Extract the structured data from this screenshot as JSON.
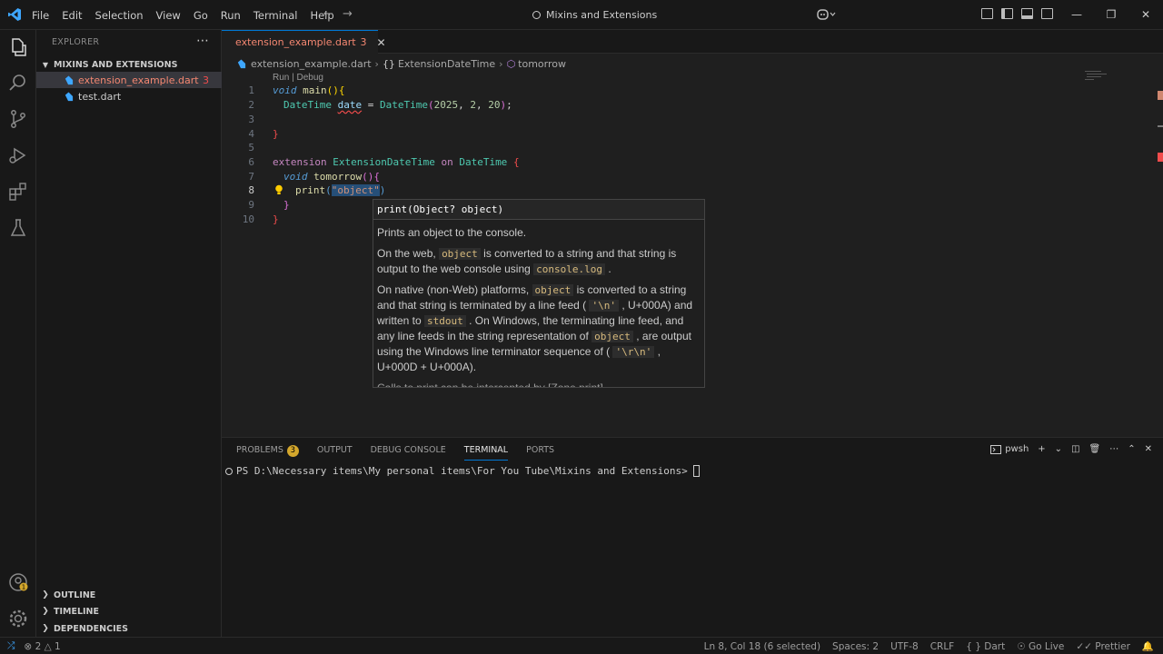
{
  "menu": [
    "File",
    "Edit",
    "Selection",
    "View",
    "Go",
    "Run",
    "Terminal",
    "Help"
  ],
  "command_center": "Mixins and Extensions",
  "explorer": {
    "header": "EXPLORER",
    "folder": "MIXINS AND EXTENSIONS",
    "files": [
      {
        "name": "extension_example.dart",
        "badge": "3"
      },
      {
        "name": "test.dart"
      }
    ],
    "sections": [
      "OUTLINE",
      "TIMELINE",
      "DEPENDENCIES"
    ]
  },
  "tab": {
    "label": "extension_example.dart",
    "problems": "3"
  },
  "breadcrumbs": [
    "extension_example.dart",
    "ExtensionDateTime",
    "tomorrow"
  ],
  "codelens": "Run | Debug",
  "line_numbers": [
    "1",
    "2",
    "3",
    "4",
    "5",
    "6",
    "7",
    "8",
    "9",
    "10"
  ],
  "code": {
    "l1": {
      "kw": "void",
      "fn": "main",
      "p1": "(",
      "p2": ")",
      "b": "{"
    },
    "l2": {
      "ty": "DateTime",
      "var": "date",
      "eq": " = ",
      "ctor": "DateTime",
      "open": "(",
      "n1": "2025",
      "c1": ", ",
      "n2": "2",
      "c2": ", ",
      "n3": "20",
      "close": ")",
      "semi": ";"
    },
    "l4": {
      "b": "}"
    },
    "l6": {
      "kw": "extension",
      "name": "ExtensionDateTime",
      "on": "on",
      "ty": "DateTime",
      "b": "{"
    },
    "l7": {
      "kw": "void",
      "fn": "tomorrow",
      "p1": "(",
      "p2": ")",
      "b": "{"
    },
    "l8": {
      "fn": "print",
      "open": "(",
      "str": "\"object\"",
      "close": ")"
    },
    "l9": {
      "b": "}"
    },
    "l10": {
      "b": "}"
    }
  },
  "hover": {
    "signature": "print(Object? object)",
    "p1": "Prints an object to the console.",
    "p2a": "On the web,",
    "p2code1": "object",
    "p2b": "is converted to a string and that string is output to the web console using",
    "p2code2": "console.log",
    "p2c": ".",
    "p3a": "On native (non-Web) platforms,",
    "p3code1": "object",
    "p3b": "is converted to a string and that string is terminated by a line feed (",
    "p3code2": "'\\n'",
    "p3c": ", U+000A) and written to",
    "p3code3": "stdout",
    "p3d": ". On Windows, the terminating line feed, and any line feeds in the string representation of",
    "p3code4": "object",
    "p3e": ", are output using the Windows line terminator sequence of (",
    "p3code5": "'\\r\\n'",
    "p3f": ", U+000D + U+000A).",
    "p4": "Calls to  print  can be intercepted by [Zone.print]."
  },
  "panel": {
    "tabs": [
      "PROBLEMS",
      "OUTPUT",
      "DEBUG CONSOLE",
      "TERMINAL",
      "PORTS"
    ],
    "problems_count": "3",
    "active_tab": "TERMINAL",
    "shell": "pwsh",
    "prompt": "PS D:\\Necessary items\\My personal items\\For You Tube\\Mixins and Extensions>"
  },
  "status": {
    "errors": "2",
    "warnings": "1",
    "position": "Ln 8, Col 18 (6 selected)",
    "spaces": "Spaces: 2",
    "encoding": "UTF-8",
    "eol": "CRLF",
    "language": "Dart",
    "golive": "Go Live",
    "prettier": "Prettier"
  },
  "colors": {
    "accent": "#0078d4",
    "error": "#f14c4c",
    "warning_badge": "#d4a72c"
  }
}
